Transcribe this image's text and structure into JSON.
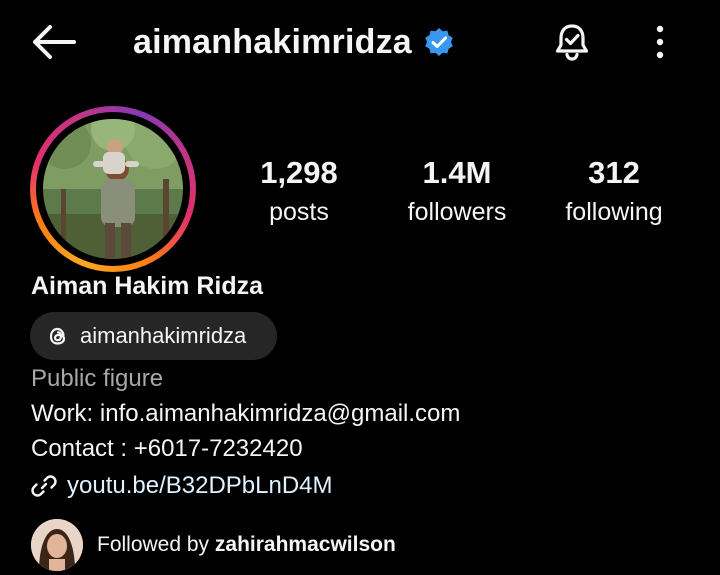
{
  "header": {
    "username": "aimanhakimridza",
    "verified_color": "#3897f0",
    "back_icon": "arrow-left-icon",
    "bell_icon": "notification-bell-icon",
    "menu_icon": "more-vertical-icon"
  },
  "stats": {
    "posts_count": "1,298",
    "posts_label": "posts",
    "followers_count": "1.4M",
    "followers_label": "followers",
    "following_count": "312",
    "following_label": "following"
  },
  "profile": {
    "name": "Aiman Hakim Ridza",
    "threads_handle": "aimanhakimridza",
    "category": "Public figure",
    "work": "Work: info.aimanhakimridza@gmail.com",
    "contact": "Contact : +6017-7232420",
    "link": "youtu.be/B32DPbLnD4M"
  },
  "followed_by": {
    "prefix": "Followed by ",
    "username": "zahirahmacwilson"
  },
  "colors": {
    "background": "#000000",
    "text": "#f5f5f5",
    "muted": "#a8a8a8",
    "chip": "#262626",
    "verified": "#3897f0"
  }
}
